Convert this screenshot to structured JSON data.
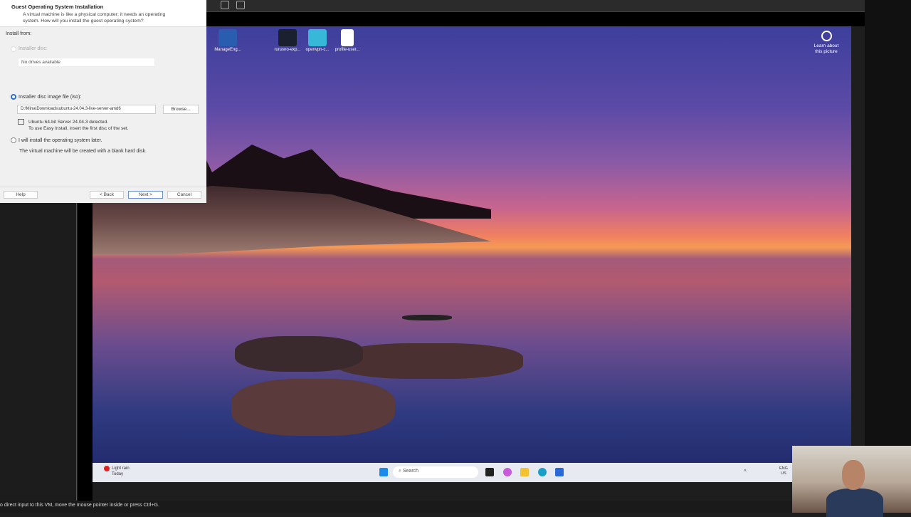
{
  "dialog": {
    "title": "Guest Operating System Installation",
    "subtitle_line1": "A virtual machine is like a physical computer; it needs an operating",
    "subtitle_line2": "system. How will you install the guest operating system?",
    "install_from_label": "Install from:",
    "installer_disc_label": "Installer disc:",
    "disc_combo_value": "No drives available",
    "iso_label": "Installer disc image file (iso):",
    "iso_path": "D:\\Mina\\Downloads\\ubuntu-24.04.3-live-server-amd6",
    "browse_label": "Browse...",
    "detected_line1": "Ubuntu 64-bit Server 24.04.3 detected.",
    "detected_line2": "To use Easy Install, insert the first disc of the set.",
    "later_label": "I will install the operating system later.",
    "later_desc": "The virtual machine will be created with a blank hard disk.",
    "help_label": "Help",
    "back_label": "< Back",
    "next_label": "Next >",
    "cancel_label": "Cancel"
  },
  "desktop": {
    "icons": [
      {
        "label": "ManageEng..."
      },
      {
        "label": "runzero-exp..."
      },
      {
        "label": "openvpn-c..."
      },
      {
        "label": "profile-user..."
      }
    ],
    "learn_line1": "Learn about",
    "learn_line2": "this picture"
  },
  "taskbar": {
    "weather_title": "Light rain",
    "weather_sub": "Today",
    "search_placeholder": "Search",
    "lang_line1": "ENG",
    "lang_line2": "US"
  },
  "statusbar": {
    "text": "o direct input to this VM, move the mouse pointer inside or press Ctrl+G."
  }
}
